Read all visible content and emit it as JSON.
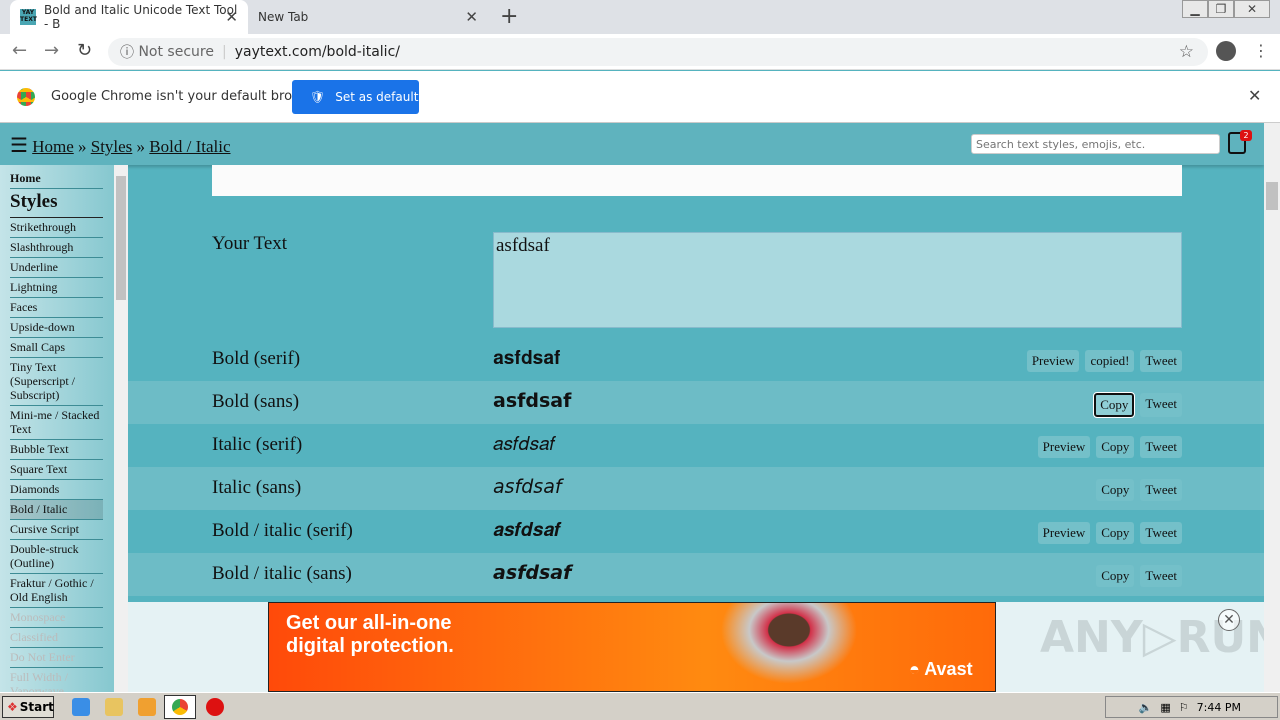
{
  "browser": {
    "tabs": [
      {
        "title": "Bold and Italic Unicode Text Tool - B",
        "favicon": "YAY TEXT"
      },
      {
        "title": "New Tab"
      }
    ],
    "security": "Not secure",
    "url": "yaytext.com/bold-italic/"
  },
  "infobar": {
    "message": "Google Chrome isn't your default browser",
    "button": "Set as default"
  },
  "header": {
    "breadcrumb": [
      "Home",
      "Styles",
      "Bold / Italic"
    ],
    "separator": "»",
    "search_placeholder": "Search text styles, emojis, etc.",
    "clipboard_count": "2"
  },
  "sidebar": {
    "home": "Home",
    "heading": "Styles",
    "items": [
      "Strikethrough",
      "Slashthrough",
      "Underline",
      "Lightning",
      "Faces",
      "Upside-down",
      "Small Caps",
      "Tiny Text (Superscript / Subscript)",
      "Mini-me / Stacked Text",
      "Bubble Text",
      "Square Text",
      "Diamonds",
      "Bold / Italic",
      "Cursive Script",
      "Double-struck (Outline)",
      "Fraktur / Gothic / Old English",
      "Monospace",
      "Classified",
      "Do Not Enter",
      "Full Width / Vaporwave"
    ],
    "active": "Bold / Italic"
  },
  "main": {
    "input_label": "Your Text",
    "input_value": "asfdsaf",
    "rows": [
      {
        "label": "Bold (serif)",
        "output": "𝐚𝐬𝐟𝐝𝐬𝐚𝐟",
        "buttons": [
          "Preview",
          "copied!",
          "Tweet"
        ]
      },
      {
        "label": "Bold (sans)",
        "output": "𝗮𝘀𝗳𝗱𝘀𝗮𝗳",
        "buttons": [
          "Copy",
          "Tweet"
        ],
        "focused": "Copy"
      },
      {
        "label": "Italic (serif)",
        "output": "𝑎𝑠𝑓𝑑𝑠𝑎𝑓",
        "buttons": [
          "Preview",
          "Copy",
          "Tweet"
        ]
      },
      {
        "label": "Italic (sans)",
        "output": "𝘢𝘴𝘧𝘥𝘴𝘢𝘧",
        "buttons": [
          "Copy",
          "Tweet"
        ]
      },
      {
        "label": "Bold / italic (serif)",
        "output": "𝒂𝒔𝒇𝒅𝒔𝒂𝒇",
        "buttons": [
          "Preview",
          "Copy",
          "Tweet"
        ]
      },
      {
        "label": "Bold / italic (sans)",
        "output": "𝙖𝙨𝙛𝙙𝙨𝙖𝙛",
        "buttons": [
          "Copy",
          "Tweet"
        ]
      }
    ]
  },
  "ad": {
    "headline": "Get our all-in-one digital protection.",
    "brand": "Avast",
    "watermark": "ANY RUN"
  },
  "taskbar": {
    "start": "Start",
    "time": "7:44 PM"
  },
  "colors": {
    "page_bg": "#55b3bf",
    "row_alt": "#6dbcc6",
    "chrome_blue": "#1a73e8",
    "ad_orange": "#ff6a0a"
  }
}
